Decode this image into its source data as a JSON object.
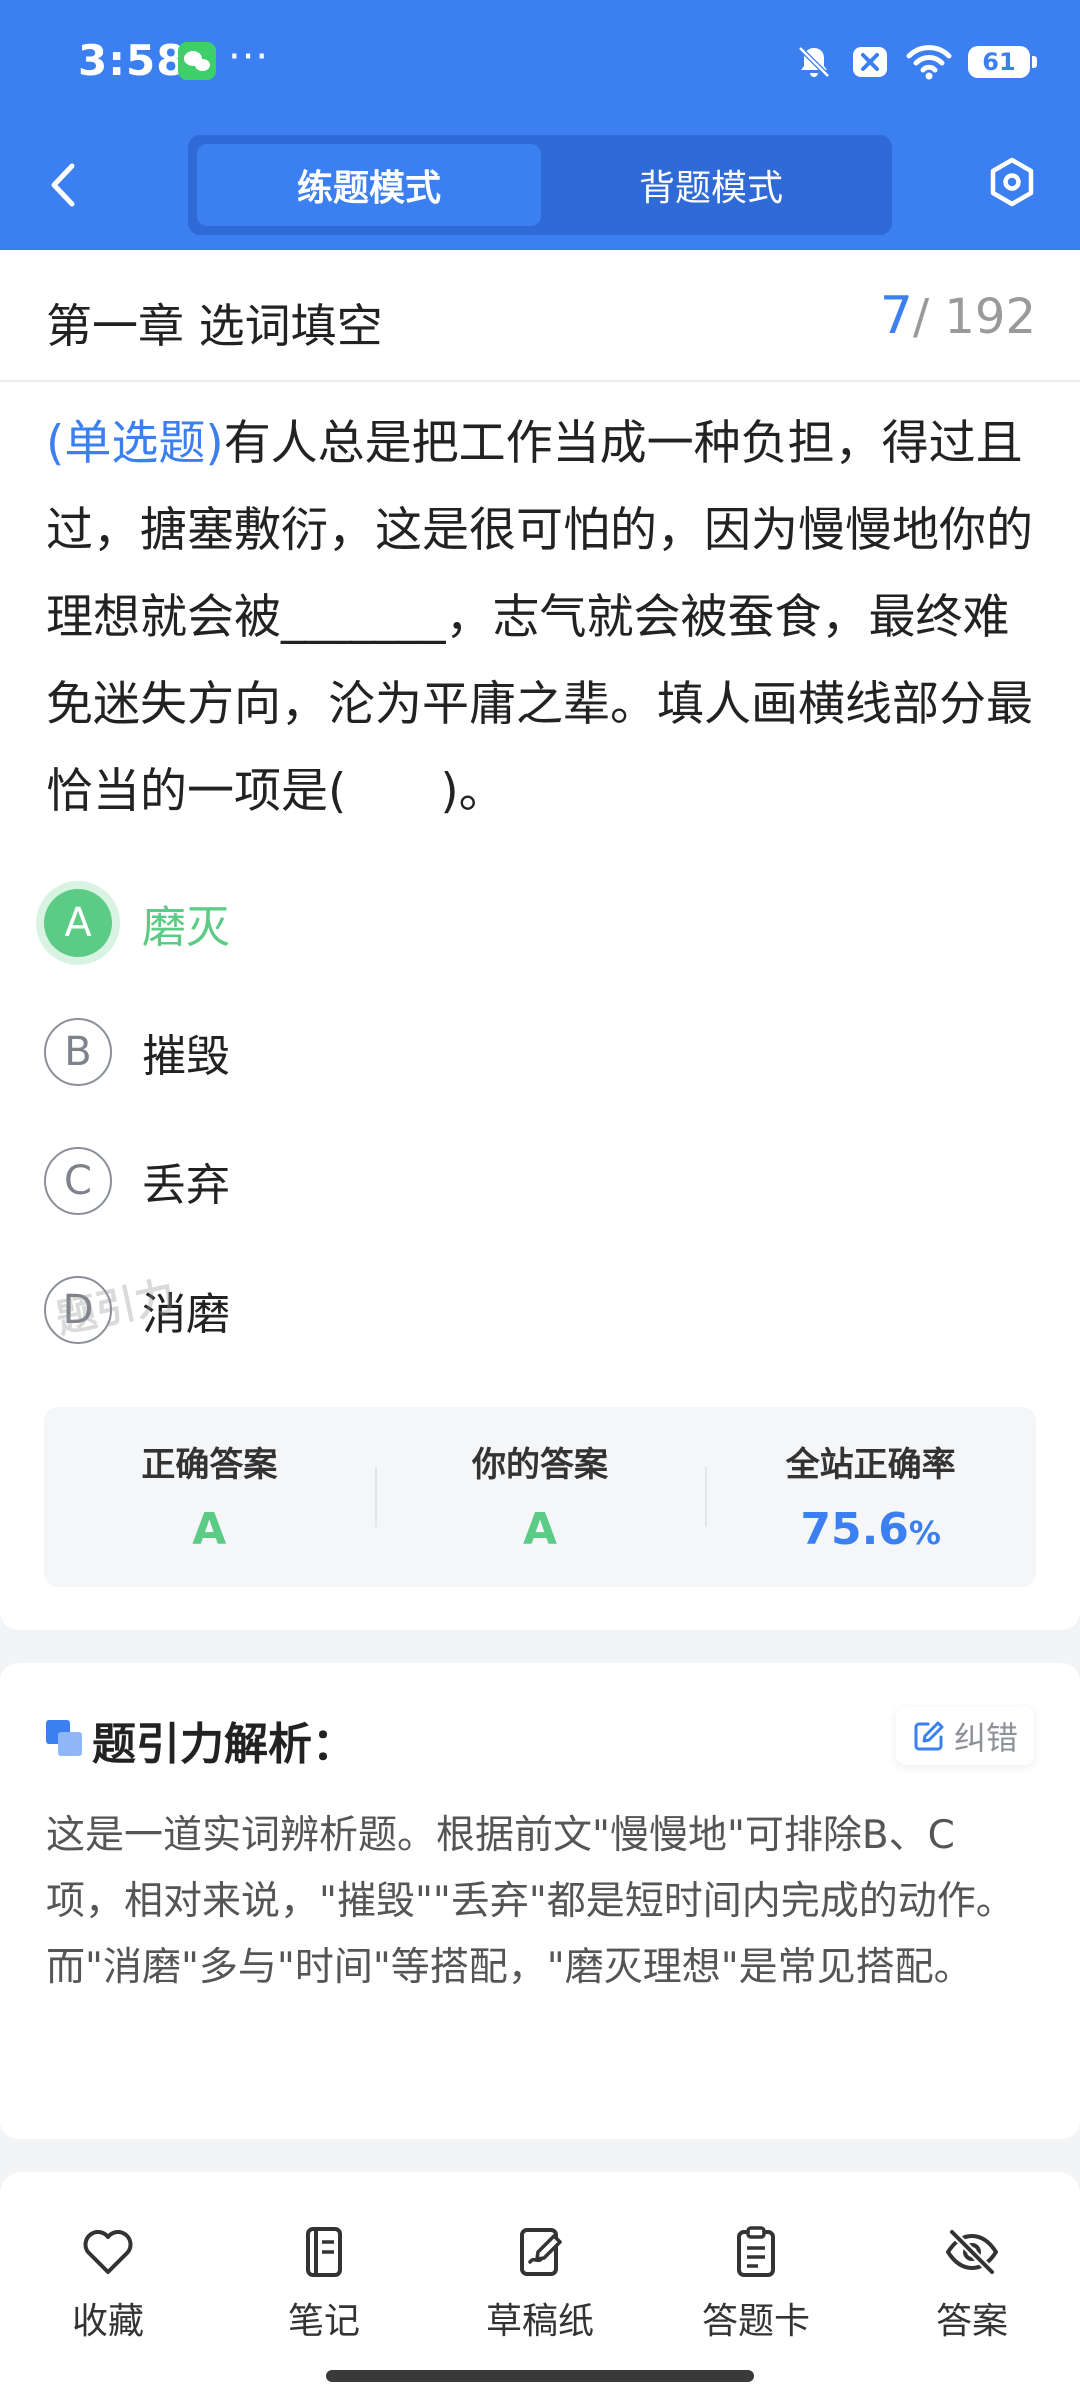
{
  "status_bar": {
    "time": "3:58",
    "more": "···",
    "battery": "61",
    "icons": [
      "wechat-icon",
      "mute-bell-icon",
      "close-box-icon",
      "wifi-icon",
      "battery-icon"
    ]
  },
  "header": {
    "tabs": [
      {
        "label": "练题模式",
        "active": true
      },
      {
        "label": "背题模式",
        "active": false
      }
    ],
    "icons": [
      "back-arrow-icon",
      "settings-hex-icon"
    ]
  },
  "question_card": {
    "chapter_title": "第一章 选词填空",
    "progress_current": "7",
    "progress_total": "/ 192",
    "type_label": "(单选题)",
    "question_text": "有人总是把工作当成一种负担，得过且过，搪塞敷衍，这是很可怕的，因为慢慢地你的理想就会被_______，志气就会被蚕食，最终难免迷失方向，沦为平庸之辈。填人画横线部分最恰当的一项是(　　)。",
    "options": [
      {
        "letter": "A",
        "text": "磨灭",
        "selected": true
      },
      {
        "letter": "B",
        "text": "摧毁",
        "selected": false
      },
      {
        "letter": "C",
        "text": "丢弃",
        "selected": false
      },
      {
        "letter": "D",
        "text": "消磨",
        "selected": false
      }
    ],
    "watermark": "题引力",
    "results": {
      "correct_label": "正确答案",
      "correct_value": "A",
      "yours_label": "你的答案",
      "yours_value": "A",
      "rate_label": "全站正确率",
      "rate_value": "75.6",
      "rate_unit": "%"
    }
  },
  "analysis": {
    "title": "题引力解析：",
    "report_label": "纠错",
    "text": "这是一道实词辨析题。根据前文\"慢慢地\"可排除B、C项，相对来说，\"摧毁\"\"丢弃\"都是短时间内完成的动作。而\"消磨\"多与\"时间\"等搭配，\"磨灭理想\"是常见搭配。"
  },
  "bottom_bar": [
    {
      "label": "收藏",
      "icon": "heart-icon"
    },
    {
      "label": "笔记",
      "icon": "notebook-icon"
    },
    {
      "label": "草稿纸",
      "icon": "draft-paper-icon"
    },
    {
      "label": "答题卡",
      "icon": "answer-card-icon"
    },
    {
      "label": "答案",
      "icon": "eye-off-icon"
    }
  ],
  "colors": {
    "primary": "#3b7ff0",
    "primary_dark": "#2f6ad6",
    "correct_green": "#5ccb85",
    "text_dark": "#222222",
    "text_muted": "#555555",
    "background": "#f3f4f6"
  }
}
